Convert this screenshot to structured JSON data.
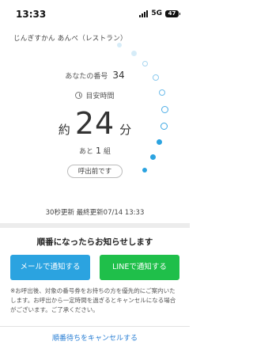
{
  "status_bar": {
    "time": "13:33",
    "network": "5G",
    "battery": "47"
  },
  "shop_name": "じんぎすかん あんべ（レストラン）",
  "queue": {
    "your_number_label": "あなたの番号",
    "your_number": "34",
    "estimate_label": "目安時間",
    "approx_prefix": "約",
    "wait_minutes": "24",
    "minutes_suffix": "分",
    "remaining_prefix": "あと",
    "remaining_groups": "1",
    "groups_suffix": "組",
    "call_status": "呼出前です"
  },
  "accent_color": "#2ba3e0",
  "update_info": "30秒更新 最終更新07/14 13:33",
  "notify": {
    "title": "順番になったらお知らせします",
    "mail_button": "メールで通知する",
    "line_button": "LINEで通知する",
    "mail_color": "#2ba3e0",
    "line_color": "#1fbf4a",
    "note": "※お呼出後、対象の番号券をお持ちの方を優先的にご案内いたします。お呼出から一定時間を過ぎるとキャンセルになる場合がございます。ご了承ください。"
  },
  "cancel_link": "順番待ちをキャンセルする"
}
